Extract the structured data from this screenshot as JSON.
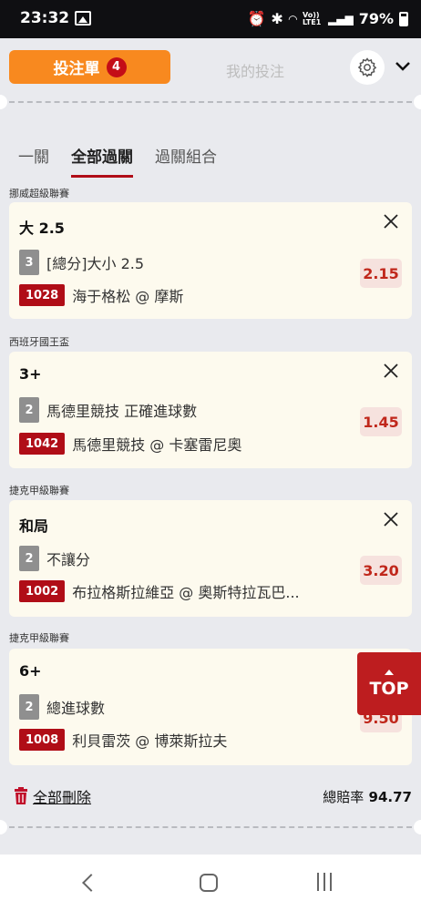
{
  "status_bar": {
    "time": "23:32",
    "volte": "Vo)) LTE1",
    "battery": "79%"
  },
  "header": {
    "bet_slip_label": "投注單",
    "bet_count": "4",
    "my_bets_label": "我的投注"
  },
  "subtabs": [
    "一關",
    "全部過關",
    "過關組合"
  ],
  "active_subtab": 1,
  "bets": [
    {
      "league": "挪威超級聯賽",
      "selection": "大 2.5",
      "num": "3",
      "market": "[總分]大小 2.5",
      "match_code": "1028",
      "match": "海于格松 @ 摩斯",
      "odds": "2.15"
    },
    {
      "league": "西班牙國王盃",
      "selection": "3+",
      "num": "2",
      "market": "馬德里競技 正確進球數",
      "match_code": "1042",
      "match": "馬德里競技 @ 卡塞雷尼奧",
      "odds": "1.45"
    },
    {
      "league": "捷克甲級聯賽",
      "selection": "和局",
      "num": "2",
      "market": "不讓分",
      "match_code": "1002",
      "match": "布拉格斯拉維亞 @ 奧斯特拉瓦巴...",
      "odds": "3.20"
    },
    {
      "league": "捷克甲級聯賽",
      "selection": "6+",
      "num": "2",
      "market": "總進球數",
      "match_code": "1008",
      "match": "利貝雷茨 @ 博萊斯拉夫",
      "odds": "9.50"
    }
  ],
  "top_button": "TOP",
  "footer": {
    "delete_all": "全部刪除",
    "total_odds_label": "總賠率",
    "total_odds": "94.77"
  },
  "colors": {
    "orange": "#f8891f",
    "red": "#b00d17",
    "card_bg": "#fdfaee",
    "odds_bg": "#f6e2de"
  }
}
